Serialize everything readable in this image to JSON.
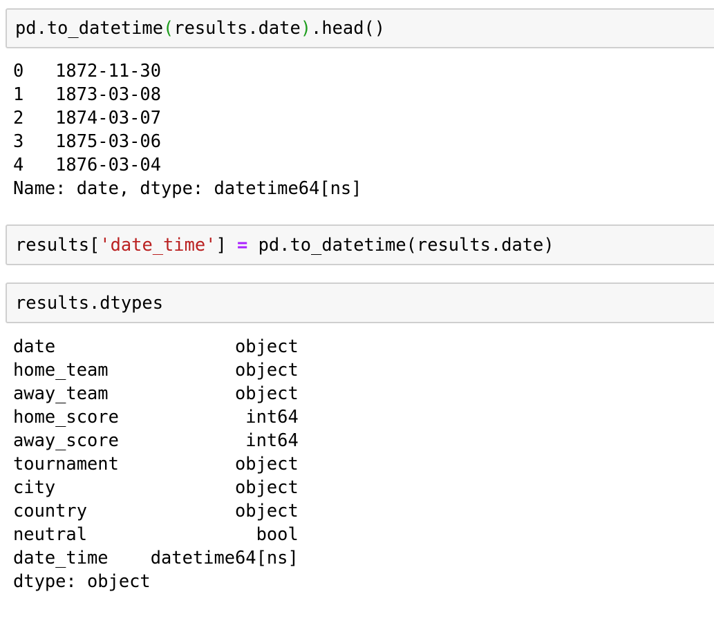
{
  "cells": [
    {
      "input": {
        "p1": "pd.to_datetime",
        "p2": "(",
        "p3": "results.date",
        "p4": ")",
        "p5": ".head()"
      },
      "output": [
        "0   1872-11-30",
        "1   1873-03-08",
        "2   1874-03-07",
        "3   1875-03-06",
        "4   1876-03-04",
        "Name: date, dtype: datetime64[ns]"
      ]
    },
    {
      "input": {
        "p1": "results[",
        "p2": "'date_time'",
        "p3": "] ",
        "p4": "=",
        "p5": " pd.to_datetime(results.date)"
      }
    },
    {
      "input": {
        "p1": "results.dtypes"
      },
      "output": [
        "date                 object",
        "home_team            object",
        "away_team            object",
        "home_score            int64",
        "away_score            int64",
        "tournament           object",
        "city                 object",
        "country              object",
        "neutral                bool",
        "date_time    datetime64[ns]",
        "dtype: object"
      ]
    }
  ],
  "colors": {
    "paren_highlight": "#1e9e1e",
    "string": "#ba2121",
    "operator": "#aa22ff",
    "cell_background": "#f7f7f7",
    "cell_border": "#cfcfcf"
  }
}
